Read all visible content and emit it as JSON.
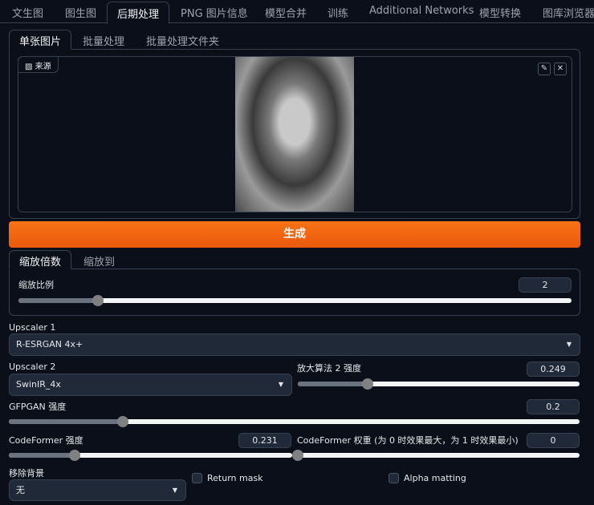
{
  "top_tabs": [
    "文生图",
    "图生图",
    "后期处理",
    "PNG 图片信息",
    "模型合并",
    "训练",
    "Additional Networks",
    "模型转换",
    "图库浏览器"
  ],
  "sub_tabs": [
    "单张图片",
    "批量处理",
    "批量处理文件夹"
  ],
  "image_label": "来源",
  "edit_icon": "✎",
  "close_icon": "✕",
  "generate": "生成",
  "scale_tabs": [
    "缩放倍数",
    "缩放到"
  ],
  "scale": {
    "label": "缩放比例",
    "value": "2",
    "fraction": 0.143
  },
  "upscaler1": {
    "label": "Upscaler 1",
    "value": "R-ESRGAN 4x+"
  },
  "upscaler2": {
    "label": "Upscaler 2",
    "value": "SwinIR_4x"
  },
  "upscaler2_strength": {
    "label": "放大算法 2 强度",
    "value": "0.249",
    "fraction": 0.249
  },
  "gfpgan": {
    "label": "GFPGAN 强度",
    "value": "0.2",
    "fraction": 0.2
  },
  "codeformer": {
    "label": "CodeFormer 强度",
    "value": "0.231",
    "fraction": 0.231
  },
  "codeformer_weight": {
    "label": "CodeFormer 权重 (为 0 时效果最大，为 1 时效果最小)",
    "value": "0",
    "fraction": 0
  },
  "remove_bg": {
    "label": "移除背景",
    "value": "无"
  },
  "return_mask": "Return mask",
  "alpha_matting": "Alpha matting"
}
